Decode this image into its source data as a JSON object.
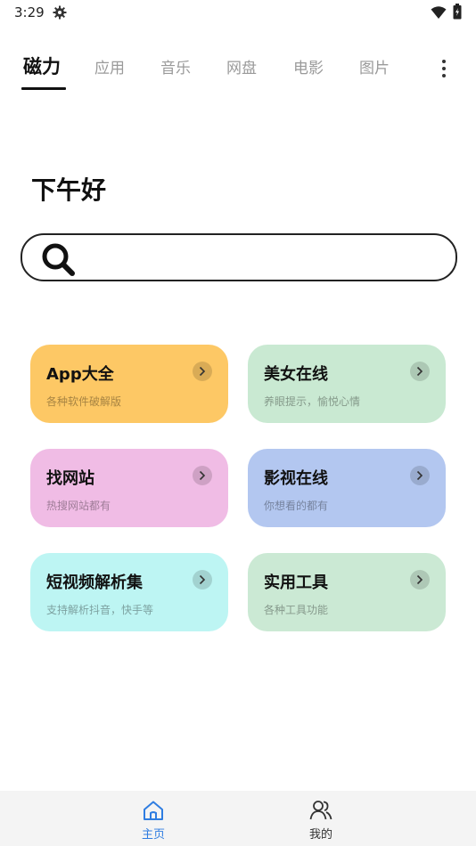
{
  "status_bar": {
    "time": "3:29"
  },
  "tabs": [
    {
      "label": "磁力",
      "active": true
    },
    {
      "label": "应用",
      "active": false
    },
    {
      "label": "音乐",
      "active": false
    },
    {
      "label": "网盘",
      "active": false
    },
    {
      "label": "电影",
      "active": false
    },
    {
      "label": "图片",
      "active": false
    }
  ],
  "greeting": "下午好",
  "search": {
    "placeholder": "",
    "value": ""
  },
  "cards": [
    {
      "title": "App大全",
      "subtitle": "各种软件破解版",
      "color": "#fdc865"
    },
    {
      "title": "美女在线",
      "subtitle": "养眼提示，愉悦心情",
      "color": "#c9e9d2"
    },
    {
      "title": "找网站",
      "subtitle": "热搜网站都有",
      "color": "#f0bce5"
    },
    {
      "title": "影视在线",
      "subtitle": "你想看的都有",
      "color": "#b3c7f0"
    },
    {
      "title": "短视频解析集",
      "subtitle": "支持解析抖音，快手等",
      "color": "#bdf5f3"
    },
    {
      "title": "实用工具",
      "subtitle": "各种工具功能",
      "color": "#cbe9d4"
    }
  ],
  "bottom_nav": [
    {
      "label": "主页",
      "icon": "home-icon",
      "active": true,
      "color": "#2f7de1"
    },
    {
      "label": "我的",
      "icon": "users-icon",
      "active": false,
      "color": "#333333"
    }
  ]
}
